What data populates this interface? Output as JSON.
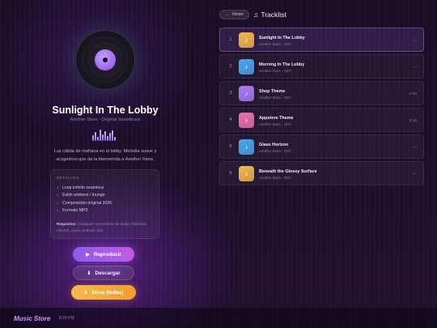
{
  "player": {
    "title": "Sunlight In The Lobby",
    "subtitle": "Another Store · Original Soundtrack",
    "description_line1": "Luz cálida de mañana en el lobby. Melodía suave y",
    "description_line2": "acogedora que da la bienvenida a Another Store."
  },
  "details": {
    "heading": "DETALLES",
    "items": [
      {
        "label": "Loop infinito seamless"
      },
      {
        "label": "Estilo ambient / lounge"
      },
      {
        "label": "Composición original 2026"
      },
      {
        "label": "Formato MP3"
      }
    ],
    "reqs_label": "Requisitos:",
    "reqs_line1": " Cualquier reproductor de audio. Windows,",
    "reqs_line2": "macOS, Linux, Android, iOS."
  },
  "buttons": {
    "play": "Reproducir",
    "download": "Descargar",
    "drive": "Drive (todas)"
  },
  "nav": {
    "back": "Volver"
  },
  "tracklist": {
    "heading": "Tracklist",
    "tracks": [
      {
        "num": "1",
        "title": "Sunlight In The Lobby",
        "sub": "Another Store · OST",
        "dur": "—",
        "color": "#f5b84a",
        "active": true
      },
      {
        "num": "2",
        "title": "Morning In The Lobby",
        "sub": "Another Store · OST",
        "dur": "—",
        "color": "#4aa8f0",
        "active": false
      },
      {
        "num": "3",
        "title": "Shop Theme",
        "sub": "Another Store · OST",
        "dur": "2:34",
        "color": "#a97cf5",
        "active": false
      },
      {
        "num": "4",
        "title": "Appstore Theme",
        "sub": "Another Store · OST",
        "dur": "3:12",
        "color": "#ee6fae",
        "active": false
      },
      {
        "num": "5",
        "title": "Glass Horizon",
        "sub": "Another Store · OST",
        "dur": "—",
        "color": "#4aa8f0",
        "active": false
      },
      {
        "num": "6",
        "title": "Beneath the Glossy Surface",
        "sub": "Another Store · OST",
        "dur": "—",
        "color": "#f5b84a",
        "active": false
      }
    ]
  },
  "footer": {
    "brand": "Music Store",
    "time": "8:16 PM"
  },
  "icons": {
    "track_art": "music-note-icon",
    "back": "arrow-left-icon"
  }
}
